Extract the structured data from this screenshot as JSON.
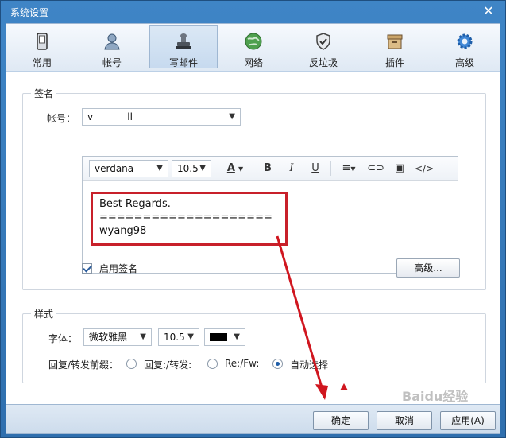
{
  "window": {
    "title": "系统设置"
  },
  "toolbar": {
    "items": [
      {
        "label": "常用",
        "icon": "phone-icon"
      },
      {
        "label": "帐号",
        "icon": "user-icon"
      },
      {
        "label": "写邮件",
        "icon": "stamp-icon",
        "active": true
      },
      {
        "label": "网络",
        "icon": "globe-icon"
      },
      {
        "label": "反垃圾",
        "icon": "shield-icon"
      },
      {
        "label": "插件",
        "icon": "box-icon"
      },
      {
        "label": "高级",
        "icon": "gear-icon"
      }
    ]
  },
  "signature": {
    "legend": "签名",
    "account_label": "帐号：",
    "account_value": "v                  ll",
    "editor": {
      "font": "verdana",
      "size": "10.5",
      "text": "Best Regards.\n====================\nwyang98"
    },
    "enable_label": "启用签名",
    "enabled": true,
    "advanced_button": "高级..."
  },
  "style": {
    "legend": "样式",
    "font_label": "字体：",
    "font_value": "微软雅黑",
    "size_value": "10.5",
    "color_value": "#000000",
    "prefix_label": "回复/转发前缀：",
    "options": [
      {
        "label": "回复:/转发:",
        "checked": false
      },
      {
        "label": "Re:/Fw:",
        "checked": false
      },
      {
        "label": "自动选择",
        "checked": true
      }
    ]
  },
  "footer": {
    "ok": "确定",
    "cancel": "取消",
    "apply": "应用(A)"
  },
  "colors": {
    "accent": "#2f6fae",
    "highlight_box": "#c8202a"
  },
  "watermark": "Baidu经验"
}
